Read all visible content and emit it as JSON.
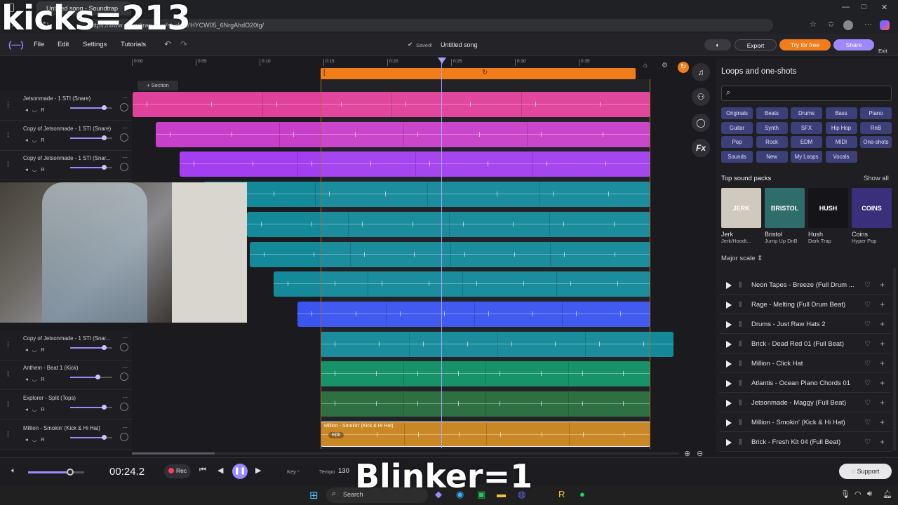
{
  "browser": {
    "tab_title": "Untitled song - Soundtrap",
    "url": "https://www.soundtrap.com/studio/YHYCW05_6NrgAhdO20tg/"
  },
  "app": {
    "menu": [
      "File",
      "Edit",
      "Settings",
      "Tutorials"
    ],
    "saved_label": "Saved!",
    "song_title": "Untitled song",
    "export_label": "Export",
    "try_label": "Try for free",
    "share_label": "Share",
    "exit_label": "Exit",
    "section_label": "+ Section"
  },
  "ruler": [
    "0:00",
    "0:05",
    "0:10",
    "0:15",
    "0:20",
    "0:25",
    "0:30",
    "0:35"
  ],
  "tracks": [
    {
      "name": "Jetsonmade - 1 STI (Snare)",
      "color": "#e0419a",
      "volume": 0.8
    },
    {
      "name": "Copy of Jetsonmade - 1 STI (Snare)",
      "color": "#c83fc9",
      "volume": 0.8
    },
    {
      "name": "Copy of Jetsonmade - 1 STI (Snar...",
      "color": "#a33ff0",
      "volume": 0.8
    },
    {
      "name": "",
      "color": "#13899a",
      "volume": 0.8
    },
    {
      "name": "",
      "color": "#13899a",
      "volume": 0.8
    },
    {
      "name": "",
      "color": "#13899a",
      "volume": 0.8
    },
    {
      "name": "",
      "color": "#13899a",
      "volume": 0.8
    },
    {
      "name": "",
      "color": "#3a55f0",
      "volume": 0.8
    },
    {
      "name": "Copy of Jetsonmade - 1 STI (Snar...",
      "color": "#13899a",
      "volume": 0.8
    },
    {
      "name": "Anthem - Beat 1 (Kick)",
      "color": "#0f8f63",
      "volume": 0.65
    },
    {
      "name": "Explorer - Split (Tops)",
      "color": "#266b3a",
      "volume": 0.8
    },
    {
      "name": "Million - Smokin' (Kick & Hi Hat)",
      "color": "#c8831e",
      "volume": 0.8
    }
  ],
  "clip_label": "Million - Smokin' (Kick & Hi Hat)",
  "edit_label": "Edit",
  "panel": {
    "title": "Loops and one-shots",
    "categories": [
      "Originals",
      "Beats",
      "Drums",
      "Bass",
      "Piano",
      "Guitar",
      "Synth",
      "SFX",
      "Hip Hop",
      "RnB",
      "Pop",
      "Rock",
      "EDM",
      "MIDI",
      "One-shots",
      "Sounds",
      "New",
      "My Loops",
      "Vocals"
    ],
    "top_packs_label": "Top sound packs",
    "show_all_label": "Show all",
    "packs": [
      {
        "name": "Jerk",
        "sub": "Jerk/Hoodt...",
        "art": "JERK",
        "color": "#cfc9be"
      },
      {
        "name": "Bristol",
        "sub": "Jump Up DnB",
        "art": "BRISTOL",
        "color": "#2f6d6a"
      },
      {
        "name": "Hush",
        "sub": "Dark Trap",
        "art": "HUSH",
        "color": "#151418"
      },
      {
        "name": "Coins",
        "sub": "Hyper Pop",
        "art": "COINS",
        "color": "#3a2f7a"
      }
    ],
    "scale_label": "Major scale",
    "loops": [
      "Neon Tapes - Breeze (Full Drum ...",
      "Rage - Melting (Full Drum Beat)",
      "Drums - Just Raw Hats 2",
      "Brick - Dead Red 01 (Full Beat)",
      "Million - Click Hat",
      "Atlantis - Ocean Piano Chords 01",
      "Jetsonmade - Maggy (Full Beat)",
      "Million - Smokin' (Kick & Hi Hat)",
      "Brick - Fresh Kit 04 (Full Beat)"
    ]
  },
  "transport": {
    "time": "00:24.2",
    "rec_label": "Rec",
    "key_label": "Key",
    "key_value": "-",
    "tempo_label": "Tempo",
    "tempo_value": "130",
    "master_volume": 0.75,
    "support_label": "Support"
  },
  "taskbar": {
    "search_label": "Search"
  },
  "overlays": {
    "top": "kicks=213",
    "bottom": "Blinker=1"
  }
}
